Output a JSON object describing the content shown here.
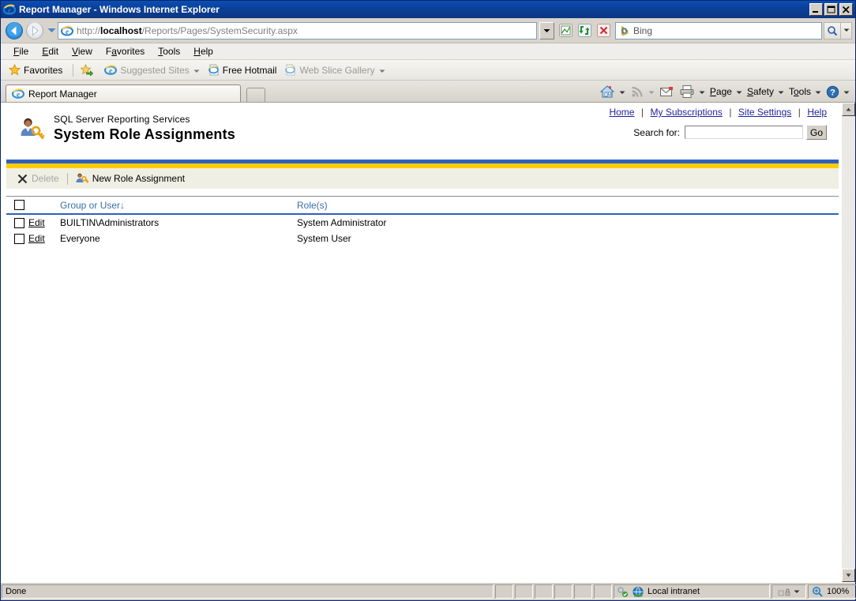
{
  "window": {
    "title": "Report Manager - Windows Internet Explorer",
    "minimize_label": "Minimize",
    "maximize_label": "Maximize",
    "close_label": "Close"
  },
  "navbar": {
    "back_label": "Back",
    "forward_label": "Forward",
    "recent_pages_label": "Recent Pages",
    "url_prefix": "http://",
    "url_host": "localhost",
    "url_path": "/Reports/Pages/SystemSecurity.aspx",
    "url_full": "http://localhost/Reports/Pages/SystemSecurity.aspx",
    "compatibility_label": "Compatibility View",
    "refresh_label": "Refresh",
    "stop_label": "Stop",
    "search_provider": "Bing",
    "search_value": "",
    "search_button_label": "Search"
  },
  "menubar": {
    "items": [
      {
        "label": "File",
        "accel": "F",
        "rest": "ile"
      },
      {
        "label": "Edit",
        "accel": "E",
        "rest": "dit"
      },
      {
        "label": "View",
        "accel": "V",
        "rest": "iew"
      },
      {
        "label": "Favorites",
        "pre": "F",
        "accel": "a",
        "rest": "vorites"
      },
      {
        "label": "Tools",
        "accel": "T",
        "rest": "ools"
      },
      {
        "label": "Help",
        "accel": "H",
        "rest": "elp"
      }
    ]
  },
  "favoritesbar": {
    "favorites_label": "Favorites",
    "add_label": "Add to Favorites Bar",
    "items": [
      {
        "label": "Suggested Sites",
        "dimmed": true,
        "has_caret": true
      },
      {
        "label": "Free Hotmail",
        "dimmed": false,
        "has_caret": false
      },
      {
        "label": "Web Slice Gallery",
        "dimmed": true,
        "has_caret": true
      }
    ]
  },
  "tabs": {
    "items": [
      {
        "label": "Report Manager",
        "active": true
      }
    ],
    "new_tab_label": "New Tab"
  },
  "commandbar": {
    "items": [
      {
        "label": "Home",
        "icon": "home-icon",
        "caret": true,
        "text": false
      },
      {
        "label": "Feeds",
        "icon": "rss-icon",
        "caret": true,
        "text": false
      },
      {
        "label": "Read Mail",
        "icon": "mail-icon",
        "caret": false,
        "text": false
      },
      {
        "label": "Print",
        "icon": "print-icon",
        "caret": true,
        "text": false
      },
      {
        "label": "Page",
        "accel": "P",
        "rest": "age",
        "caret": true,
        "text": true
      },
      {
        "label": "Safety",
        "accel": "S",
        "rest": "afety",
        "caret": true,
        "text": true
      },
      {
        "label": "Tools",
        "pre": "T",
        "accel": "o",
        "rest": "ols",
        "caret": true,
        "text": true
      },
      {
        "label": "Help",
        "icon": "help-icon",
        "caret": true,
        "text": false
      }
    ]
  },
  "page_header": {
    "icon": "user-key-icon",
    "product": "SQL Server Reporting Services",
    "title": "System Role Assignments",
    "nav_links": [
      {
        "label": "Home"
      },
      {
        "label": "My Subscriptions"
      },
      {
        "label": "Site Settings"
      },
      {
        "label": "Help"
      }
    ],
    "nav_separator": "|",
    "search_label": "Search for:",
    "search_value": "",
    "search_button": "Go"
  },
  "colors": {
    "accent_blue": "#2f5fc0",
    "accent_gold": "#ffcc00",
    "link_blue": "#1f1f9f",
    "header_link": "#3a6ea5",
    "toolbar_bg": "#f0efe4"
  },
  "toolbar": {
    "delete_label": "Delete",
    "delete_disabled": true,
    "separator": "|",
    "new_role_label": "New Role Assignment",
    "new_role_icon": "user-key-icon"
  },
  "grid": {
    "select_all_checked": false,
    "columns": {
      "group_or_user": "Group or User",
      "sort_indicator": "↓",
      "roles": "Role(s)"
    },
    "edit_label": "Edit",
    "rows": [
      {
        "checked": false,
        "edit": "Edit",
        "name": "BUILTIN\\Administrators",
        "roles": "System Administrator"
      },
      {
        "checked": false,
        "edit": "Edit",
        "name": "Everyone",
        "roles": "System User"
      }
    ]
  },
  "statusbar": {
    "status_text": "Done",
    "zone_icon": "globe-icon",
    "zone_label": "Local intranet",
    "protected_mode_icon": "lock-icon",
    "zoom_icon": "magnifier-icon",
    "zoom_level": "100%"
  }
}
